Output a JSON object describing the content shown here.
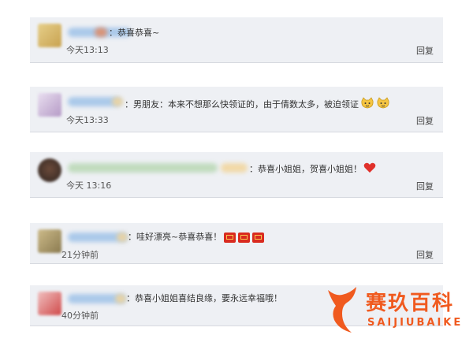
{
  "comments": [
    {
      "text": "：恭喜恭喜~",
      "time": "今天13:13",
      "reply": "回复"
    },
    {
      "text": "：男朋友：本来不想那么快领证的，由于倩数太多，被迫领证",
      "time": "今天13:33",
      "reply": "回复"
    },
    {
      "text": "：恭喜小姐姐，贺喜小姐姐！",
      "time": "今天 13:16",
      "reply": "回复"
    },
    {
      "text": "：哇好漂亮~恭喜恭喜！",
      "time": "21分钟前",
      "reply": "回复"
    },
    {
      "text": "：恭喜小姐姐喜结良缘，要永远幸福哦！",
      "time": "40分钟前",
      "reply": ""
    }
  ],
  "watermark": {
    "brand": "赛玖百科",
    "sub": "SAIJIUBAIKE"
  },
  "colors": {
    "card": "#eef0f4",
    "accent": "#f05a1f",
    "heart": "#e0312b",
    "redpacket": "#d92b1f"
  }
}
